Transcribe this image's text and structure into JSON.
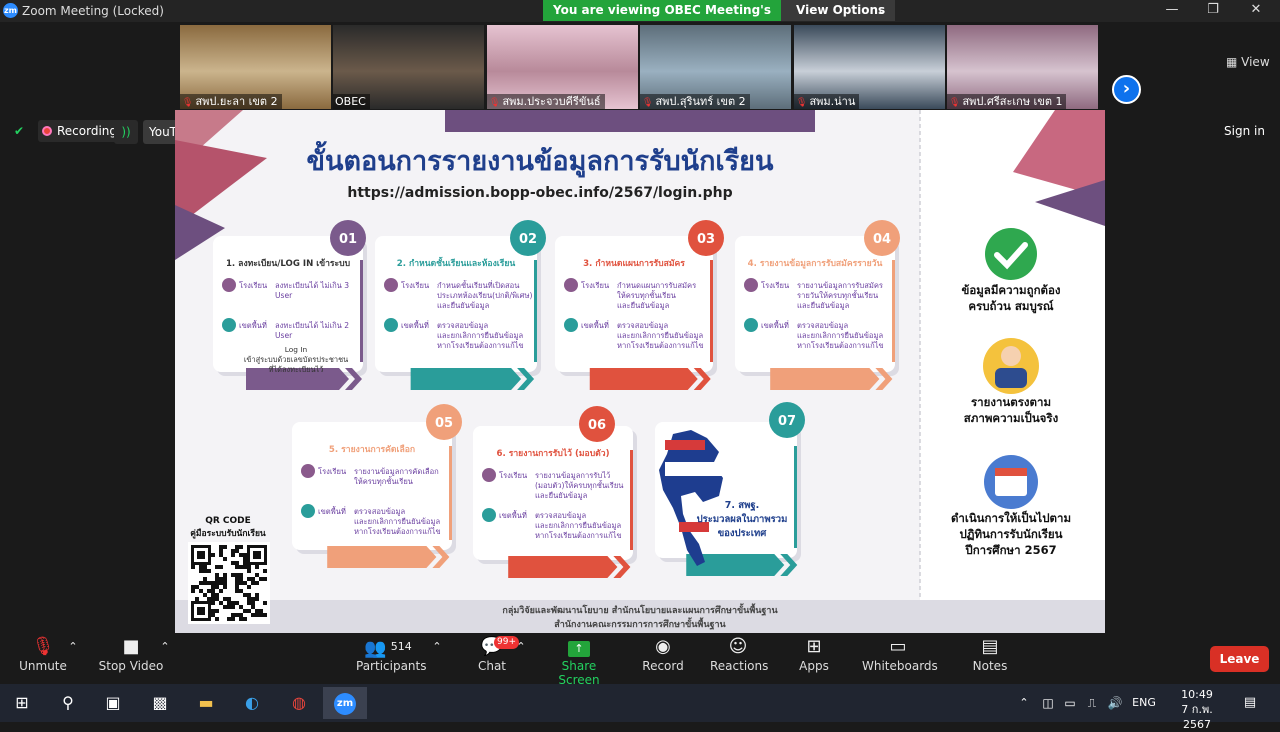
{
  "window": {
    "app_logo": "zm",
    "title": "Zoom Meeting (Locked)",
    "controls": [
      "minimize-icon",
      "maximize-icon",
      "close-icon"
    ]
  },
  "share_banner": {
    "text": "You are viewing OBEC Meeting's screen",
    "view_options": "View Options"
  },
  "participants_strip": [
    {
      "name": "สพป.ยะลา เขต 2",
      "muted": true
    },
    {
      "name": "OBEC",
      "muted": false
    },
    {
      "name": "สพม.ประจวบคีรีขันธ์",
      "muted": true
    },
    {
      "name": "สพป.สุรินทร์ เขต 2",
      "muted": true
    },
    {
      "name": "สพม.น่าน",
      "muted": true
    },
    {
      "name": "สพป.ศรีสะเกษ เขต 1",
      "muted": true
    }
  ],
  "view_label": "View",
  "recording": {
    "label": "Recording",
    "youtube": "YouTube"
  },
  "sign_in": "Sign in",
  "slide": {
    "title": "ขั้นตอนการรายงานข้อมูลการรับนักเรียน",
    "url": "https://admission.bopp-obec.info/2567/login.php",
    "steps": [
      {
        "num": "01",
        "title": "1. ลงทะเบียน/LOG IN เข้าระบบ",
        "color": "#7b5a8c",
        "lines": [
          [
            "โรงเรียน",
            "ลงทะเบียนได้ ไม่เกิน 3 User"
          ],
          [
            "เขตพื้นที่",
            "ลงทะเบียนได้ ไม่เกิน 2 User"
          ]
        ],
        "note": "Log In เข้าสู่ระบบด้วยเลขบัตรประชาชน ที่ได้ลงทะเบียนไว้"
      },
      {
        "num": "02",
        "title": "2. กำหนดชั้นเรียนและห้องเรียน",
        "color": "#2a9d9a",
        "lines": [
          [
            "โรงเรียน",
            "กำหนดชั้นเรียนที่เปิดสอน ประเภทห้องเรียน(ปกติ/พิเศษ) และยืนยันข้อมูล"
          ],
          [
            "เขตพื้นที่",
            "ตรวจสอบข้อมูล และยกเลิกการยืนยันข้อมูล หากโรงเรียนต้องการแก้ไข"
          ]
        ],
        "note": ""
      },
      {
        "num": "03",
        "title": "3. กำหนดแผนการรับสมัคร",
        "color": "#e0523e",
        "lines": [
          [
            "โรงเรียน",
            "กำหนดแผนการรับสมัคร ให้ครบทุกชั้นเรียน และยืนยันข้อมูล"
          ],
          [
            "เขตพื้นที่",
            "ตรวจสอบข้อมูล และยกเลิกการยืนยันข้อมูล หากโรงเรียนต้องการแก้ไข"
          ]
        ],
        "note": ""
      },
      {
        "num": "04",
        "title": "4. รายงานข้อมูลการรับสมัครรายวัน",
        "color": "#f0a07a",
        "lines": [
          [
            "โรงเรียน",
            "รายงานข้อมูลการรับสมัคร รายวันให้ครบทุกชั้นเรียน และยืนยันข้อมูล"
          ],
          [
            "เขตพื้นที่",
            "ตรวจสอบข้อมูล และยกเลิกการยืนยันข้อมูล หากโรงเรียนต้องการแก้ไข"
          ]
        ],
        "note": ""
      },
      {
        "num": "05",
        "title": "5. รายงานการคัดเลือก",
        "color": "#f0a07a",
        "lines": [
          [
            "โรงเรียน",
            "รายงานข้อมูลการคัดเลือก ให้ครบทุกชั้นเรียน"
          ],
          [
            "เขตพื้นที่",
            "ตรวจสอบข้อมูล และยกเลิกการยืนยันข้อมูล หากโรงเรียนต้องการแก้ไข"
          ]
        ],
        "note": ""
      },
      {
        "num": "06",
        "title": "6. รายงานการรับไว้ (มอบตัว)",
        "color": "#e0523e",
        "lines": [
          [
            "โรงเรียน",
            "รายงานข้อมูลการรับไว้ (มอบตัว)ให้ครบทุกชั้นเรียน และยืนยันข้อมูล"
          ],
          [
            "เขตพื้นที่",
            "ตรวจสอบข้อมูล และยกเลิกการยืนยันข้อมูล หากโรงเรียนต้องการแก้ไข"
          ]
        ],
        "note": ""
      },
      {
        "num": "07",
        "title": "7. สพฐ. ประมวลผลในภาพรวม ของประเทศ",
        "color": "#2a9d9a",
        "lines": [],
        "note": ""
      }
    ],
    "qr": {
      "title": "QR CODE",
      "subtitle": "คู่มือระบบรับนักเรียน"
    },
    "side": [
      {
        "icon": "check-icon",
        "text": "ข้อมูลมีความถูกต้อง ครบถ้วน สมบูรณ์"
      },
      {
        "icon": "person-icon",
        "text": "รายงานตรงตาม สภาพความเป็นจริง"
      },
      {
        "icon": "calendar-icon",
        "text": "ดำเนินการให้เป็นไปตาม ปฏิทินการรับนักเรียน ปีการศึกษา 2567"
      }
    ],
    "footer": [
      "กลุ่มวิจัยและพัฒนานโยบาย สำนักนโยบายและแผนการศึกษาขั้นพื้นฐาน",
      "สำนักงานคณะกรรมการการศึกษาขั้นพื้นฐาน"
    ]
  },
  "toolbar": {
    "unmute": "Unmute",
    "stop_video": "Stop Video",
    "participants": "Participants",
    "participants_count": "514",
    "chat": "Chat",
    "chat_badge": "99+",
    "share_screen": "Share Screen",
    "record": "Record",
    "reactions": "Reactions",
    "apps": "Apps",
    "whiteboards": "Whiteboards",
    "notes": "Notes",
    "leave": "Leave"
  },
  "taskbar": {
    "apps": [
      "windows-start-icon",
      "search-icon",
      "task-view-icon",
      "qr-app-icon",
      "file-explorer-icon",
      "edge-icon",
      "chrome-icon",
      "zoom-icon"
    ],
    "lang": "ENG",
    "time": "10:49",
    "date": "7 ก.พ. 2567"
  },
  "colors": {
    "accent_blue": "#0e72ed",
    "banner_green": "#23a43b",
    "leave_red": "#d93025",
    "slide_title_blue": "#1f3f8c"
  }
}
